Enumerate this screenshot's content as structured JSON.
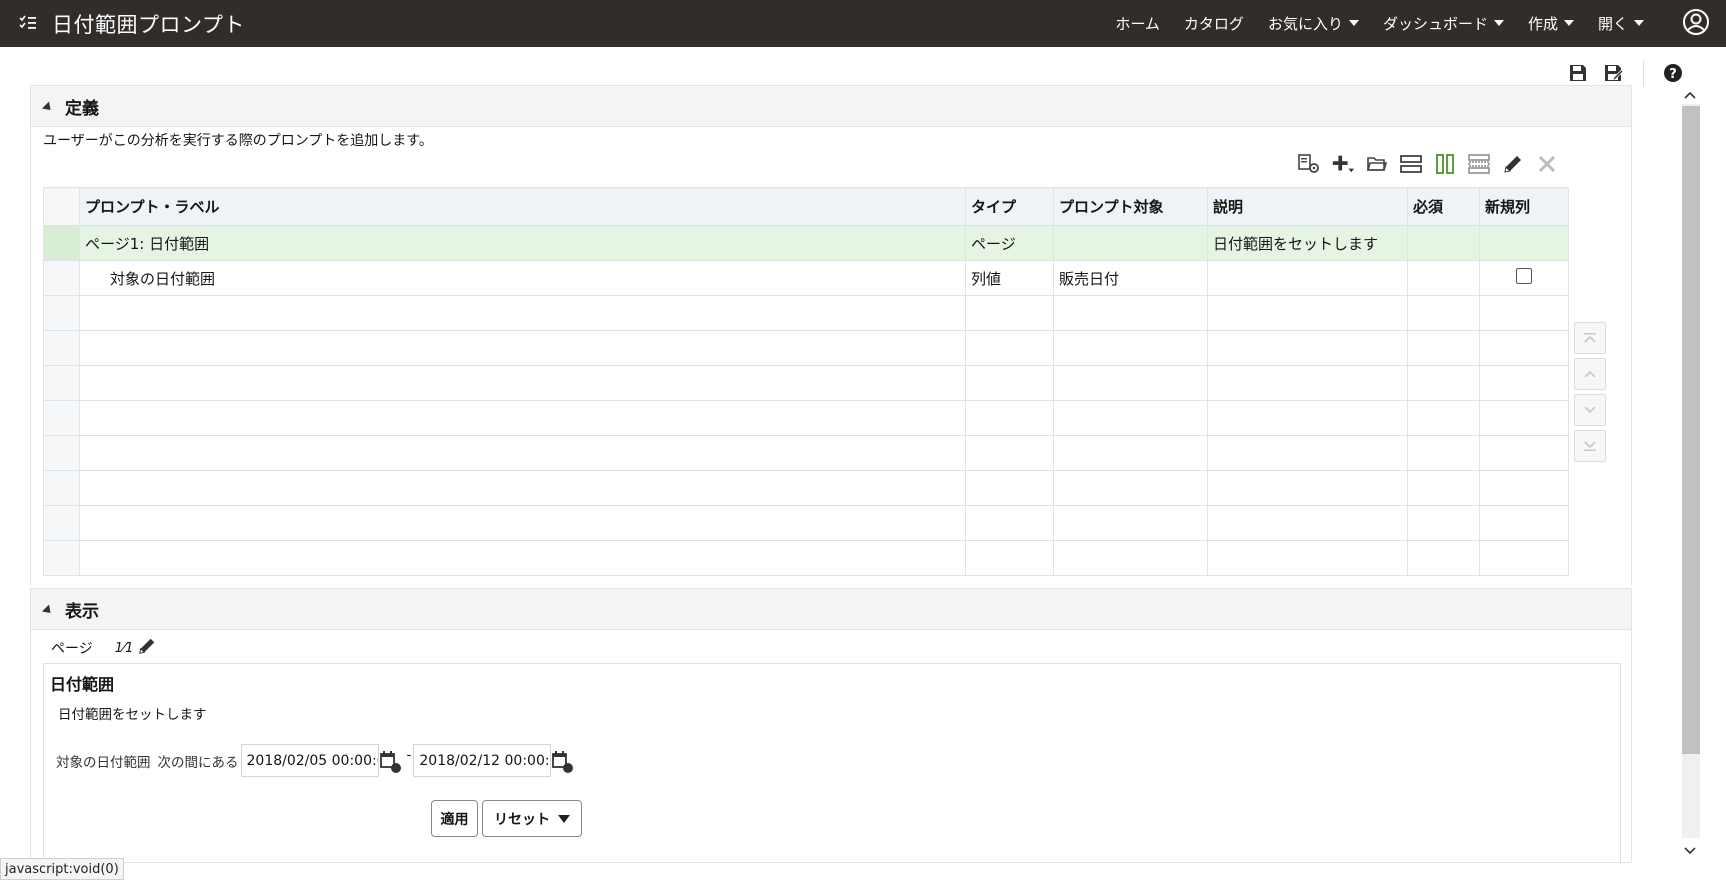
{
  "header": {
    "title": "日付範囲プロンプト",
    "nav": [
      {
        "label": "ホーム",
        "has_menu": false
      },
      {
        "label": "カタログ",
        "has_menu": false
      },
      {
        "label": "お気に入り",
        "has_menu": true
      },
      {
        "label": "ダッシュボード",
        "has_menu": true
      },
      {
        "label": "作成",
        "has_menu": true
      },
      {
        "label": "開く",
        "has_menu": true
      }
    ]
  },
  "definition": {
    "title": "定義",
    "description": "ユーザーがこの分析を実行する際のプロンプトを追加します。",
    "columns": [
      "プロンプト・ラベル",
      "タイプ",
      "プロンプト対象",
      "説明",
      "必須",
      "新規列"
    ],
    "rows": [
      {
        "label": "ページ1: 日付範囲",
        "type": "ページ",
        "target": "",
        "description": "日付範囲をセットします",
        "required": "",
        "new_column": false,
        "selected": true
      },
      {
        "label": "対象の日付範囲",
        "type": "列値",
        "target": "販売日付",
        "description": "",
        "required": "",
        "new_column": true,
        "selected": false
      }
    ],
    "empty_rows": 8
  },
  "display": {
    "title": "表示",
    "tab_label": "ページ",
    "page_indicator": "1⁄1",
    "prompt_title": "日付範囲",
    "prompt_description": "日付範囲をセットします",
    "field_label": "対象の日付範囲",
    "operator": "次の間にある",
    "from_value": "2018/02/05 00:00:00",
    "separator": "-",
    "to_value": "2018/02/12 00:00:00",
    "apply_label": "適用",
    "reset_label": "リセット"
  },
  "status_bar": "javascript:void(0)",
  "colors": {
    "header_bg": "#312d2a",
    "selected_row": "#e6f4e4",
    "table_header": "#eef3f8",
    "accent_green": "#5a9e3a"
  }
}
